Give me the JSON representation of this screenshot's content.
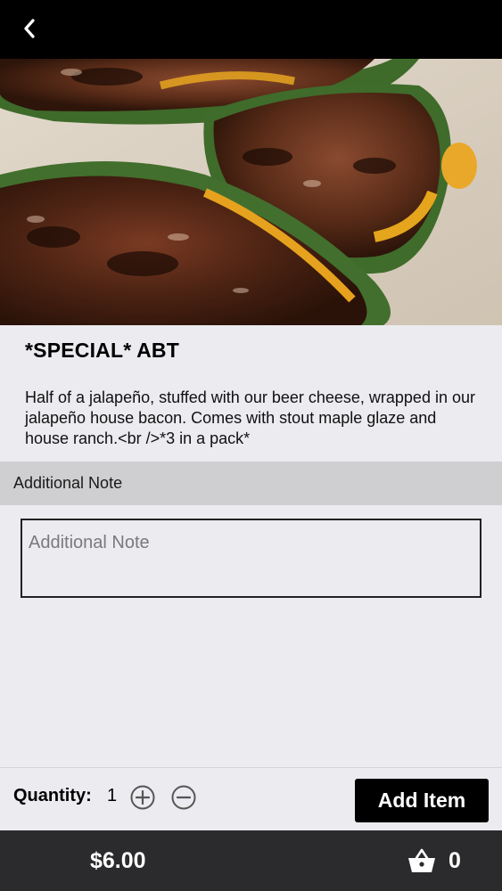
{
  "header": {
    "back_icon": "chevron-left-icon"
  },
  "item": {
    "title": "*SPECIAL* ABT",
    "description": "Half of a jalapeño, stuffed with our beer cheese, wrapped in our jalapeño house bacon. Comes with stout maple glaze and house ranch.<br />*3 in a pack*",
    "image": "food-photo"
  },
  "note": {
    "section_label": "Additional Note",
    "placeholder": "Additional Note",
    "value": ""
  },
  "quantity": {
    "label": "Quantity:",
    "value": "1",
    "increment_icon": "plus-circle-icon",
    "decrement_icon": "minus-circle-icon"
  },
  "actions": {
    "add_label": "Add Item"
  },
  "cart": {
    "total": "$6.00",
    "count": "0",
    "icon": "basket-icon"
  },
  "colors": {
    "topbar": "#000000",
    "background": "#ebebf0",
    "section_header": "#cfcfd1",
    "bottom_bar": "#2b2b2d",
    "button": "#000000"
  }
}
